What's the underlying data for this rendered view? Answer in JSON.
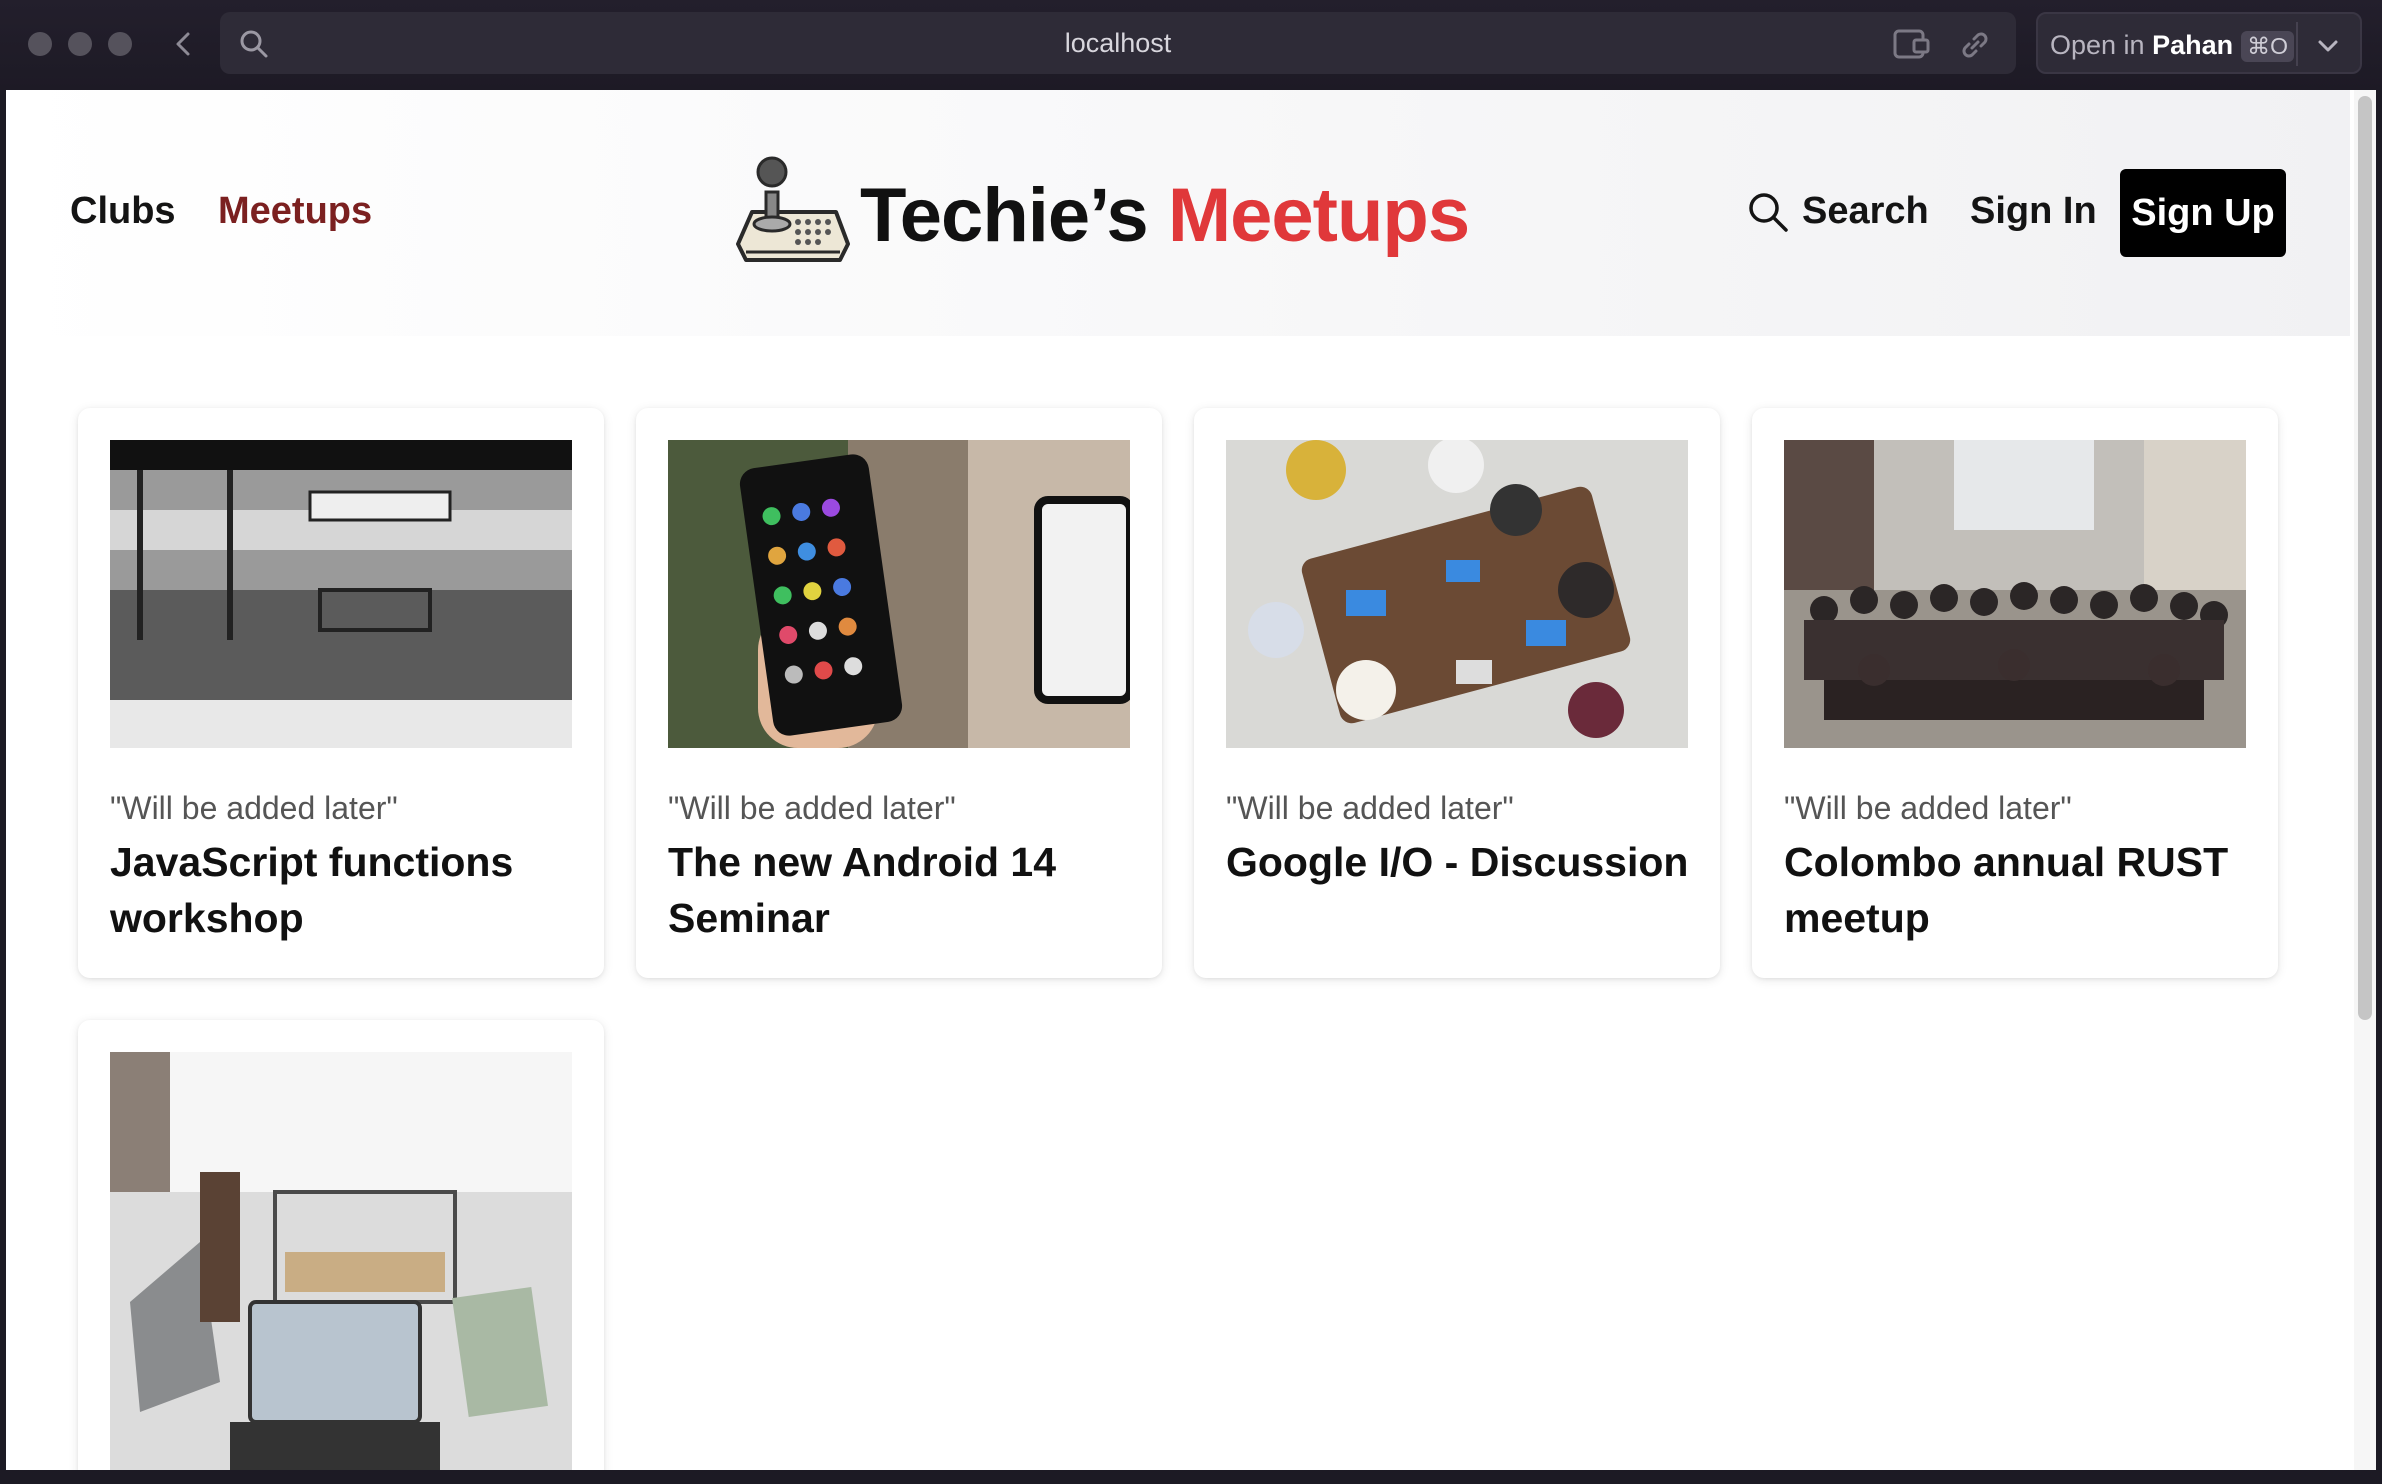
{
  "browser": {
    "url": "localhost",
    "open_in_prefix": "Open in",
    "open_in_app": "Pahan",
    "open_in_shortcut": "⌘O"
  },
  "header": {
    "nav": [
      {
        "label": "Clubs",
        "active": false
      },
      {
        "label": "Meetups",
        "active": true
      }
    ],
    "logo_text_primary": "Techie’s",
    "logo_text_accent": "Meetups",
    "search_label": "Search",
    "signin_label": "Sign In",
    "signup_label": "Sign Up"
  },
  "meetups": [
    {
      "meta": "\"Will be added later\"",
      "title": "JavaScript functions workshop",
      "image": "train-station-photo"
    },
    {
      "meta": "\"Will be added later\"",
      "title": "The new Android 14 Seminar",
      "image": "android-phone-photo"
    },
    {
      "meta": "\"Will be added later\"",
      "title": "Google I/O - Discussion",
      "image": "team-meeting-photo"
    },
    {
      "meta": "\"Will be added later\"",
      "title": "Colombo annual RUST meetup",
      "image": "group-photo"
    },
    {
      "meta": "",
      "title": "",
      "image": "laptop-desk-photo"
    }
  ],
  "colors": {
    "accent": "#e0383a",
    "active_nav": "#7b2020",
    "signup_bg": "#000000"
  }
}
